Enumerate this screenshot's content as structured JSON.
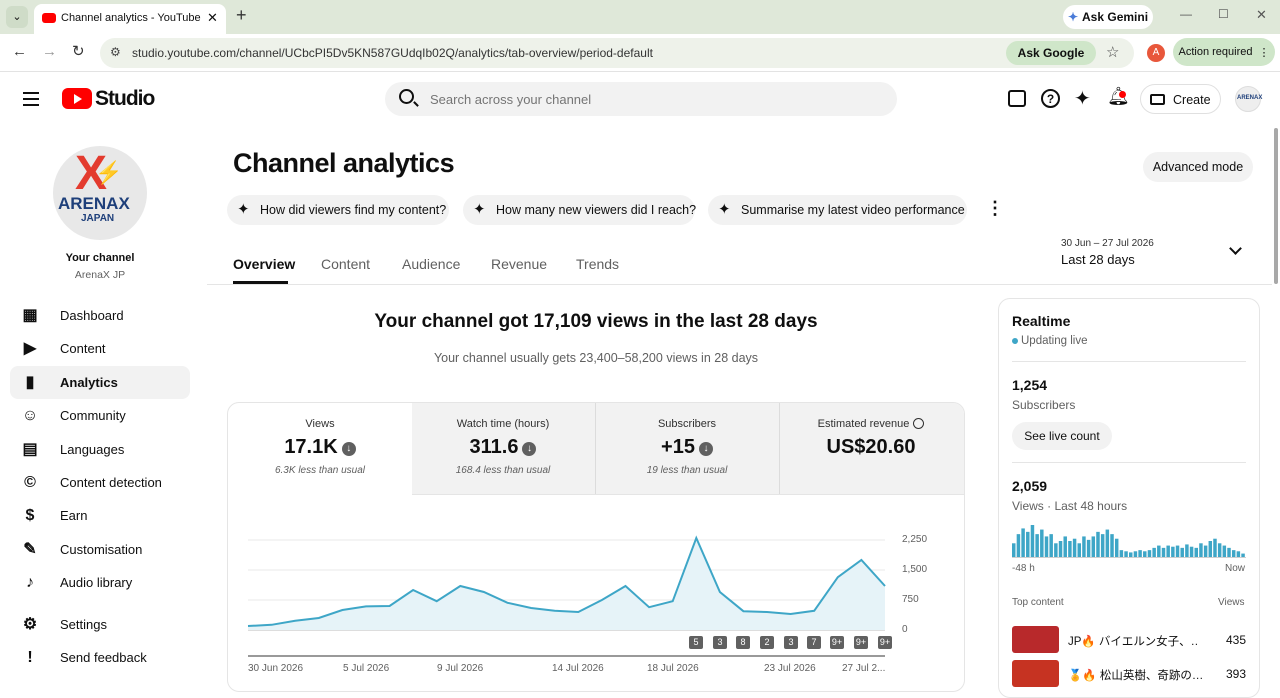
{
  "browser": {
    "tab_title": "Channel analytics - YouTube Stu",
    "url": "studio.youtube.com/channel/UCbcPI5Dv5KN587GUdqIb02Q/analytics/tab-overview/period-default",
    "ask_gemini": "Ask Gemini",
    "ask_google": "Ask Google",
    "profile_initial": "A",
    "action_required": "Action required"
  },
  "header": {
    "logo_text": "Studio",
    "search_placeholder": "Search across your channel",
    "create_label": "Create"
  },
  "channel": {
    "your_channel": "Your channel",
    "name": "ArenaX JP",
    "logo_text": "ARENAX",
    "logo_sub": "JAPAN"
  },
  "sidebar": {
    "items": [
      {
        "label": "Dashboard",
        "icon": "dashboard-icon"
      },
      {
        "label": "Content",
        "icon": "content-icon"
      },
      {
        "label": "Analytics",
        "icon": "analytics-icon"
      },
      {
        "label": "Community",
        "icon": "community-icon"
      },
      {
        "label": "Languages",
        "icon": "languages-icon"
      },
      {
        "label": "Content detection",
        "icon": "copyright-icon"
      },
      {
        "label": "Earn",
        "icon": "dollar-icon"
      },
      {
        "label": "Customisation",
        "icon": "magic-wand-icon"
      },
      {
        "label": "Audio library",
        "icon": "music-icon"
      },
      {
        "label": "Settings",
        "icon": "gear-icon"
      },
      {
        "label": "Send feedback",
        "icon": "feedback-icon"
      }
    ],
    "active": "Analytics"
  },
  "page": {
    "title": "Channel analytics",
    "advanced_mode": "Advanced mode",
    "ask_chips": [
      "How did viewers find my content?",
      "How many new viewers did I reach?",
      "Summarise my latest video performance"
    ],
    "tabs": [
      "Overview",
      "Content",
      "Audience",
      "Revenue",
      "Trends"
    ],
    "active_tab": "Overview",
    "period_range": "30 Jun – 27 Jul 2026",
    "period_label": "Last 28 days"
  },
  "overview": {
    "headline": "Your channel got 17,109 views in the last 28 days",
    "subline": "Your channel usually gets 23,400–58,200 views in 28 days",
    "metrics": [
      {
        "label": "Views",
        "value": "17.1K",
        "sub": "6.3K less than usual"
      },
      {
        "label": "Watch time (hours)",
        "value": "311.6",
        "sub": "168.4 less than usual"
      },
      {
        "label": "Subscribers",
        "value": "+15",
        "sub": "19 less than usual"
      },
      {
        "label": "Estimated revenue",
        "value": "US$20.60",
        "sub": ""
      }
    ]
  },
  "chart_data": {
    "type": "area",
    "x": [
      "30 Jun 2026",
      "1 Jul",
      "2 Jul",
      "3 Jul",
      "4 Jul",
      "5 Jul 2026",
      "6 Jul",
      "7 Jul",
      "8 Jul",
      "9 Jul 2026",
      "10 Jul",
      "11 Jul",
      "12 Jul",
      "13 Jul",
      "14 Jul 2026",
      "15 Jul",
      "16 Jul",
      "17 Jul",
      "18 Jul 2026",
      "19 Jul",
      "20 Jul",
      "21 Jul",
      "22 Jul",
      "23 Jul 2026",
      "24 Jul",
      "25 Jul",
      "26 Jul",
      "27 Jul 2..."
    ],
    "series": [
      {
        "values": [
          100,
          130,
          230,
          300,
          500,
          590,
          600,
          1000,
          720,
          1100,
          950,
          680,
          550,
          480,
          450,
          750,
          1100,
          570,
          720,
          2300,
          950,
          470,
          450,
          400,
          480,
          1320,
          1750,
          1100
        ]
      }
    ],
    "xtick_labels": [
      "30 Jun 2026",
      "5 Jul 2026",
      "9 Jul 2026",
      "14 Jul 2026",
      "18 Jul 2026",
      "23 Jul 2026",
      "27 Jul 2..."
    ],
    "ytick_labels": [
      "2,250",
      "1,500",
      "750",
      "0"
    ],
    "ylim": [
      0,
      2250
    ],
    "markers": [
      "5",
      "3",
      "8",
      "2",
      "3",
      "7",
      "9+",
      "9+",
      "9+"
    ],
    "color": "#3ea6c7"
  },
  "realtime": {
    "title": "Realtime",
    "updating": "Updating live",
    "subscribers_value": "1,254",
    "subscribers_label": "Subscribers",
    "see_live": "See live count",
    "views_value": "2,059",
    "views_label": "Views · Last 48 hours",
    "axis_start": "-48 h",
    "axis_end": "Now",
    "bars": [
      12,
      20,
      25,
      22,
      28,
      20,
      24,
      18,
      20,
      12,
      14,
      18,
      14,
      16,
      12,
      18,
      15,
      18,
      22,
      20,
      24,
      20,
      16,
      6,
      5,
      4,
      5,
      6,
      5,
      6,
      8,
      10,
      8,
      10,
      9,
      10,
      8,
      11,
      9,
      8,
      12,
      10,
      14,
      16,
      12,
      10,
      8,
      6,
      5,
      3
    ],
    "top_content_label": "Top content",
    "views_col_label": "Views",
    "top_content": [
      {
        "title": "JP🔥 バイエルン女子、…",
        "views": "435"
      },
      {
        "title": "🏅🔥 松山英樹、奇跡の…",
        "views": "393"
      }
    ]
  },
  "colors": {
    "accent": "#3ea6c7",
    "brand_red": "#ff0000",
    "chrome_green": "#dfe8d9"
  }
}
